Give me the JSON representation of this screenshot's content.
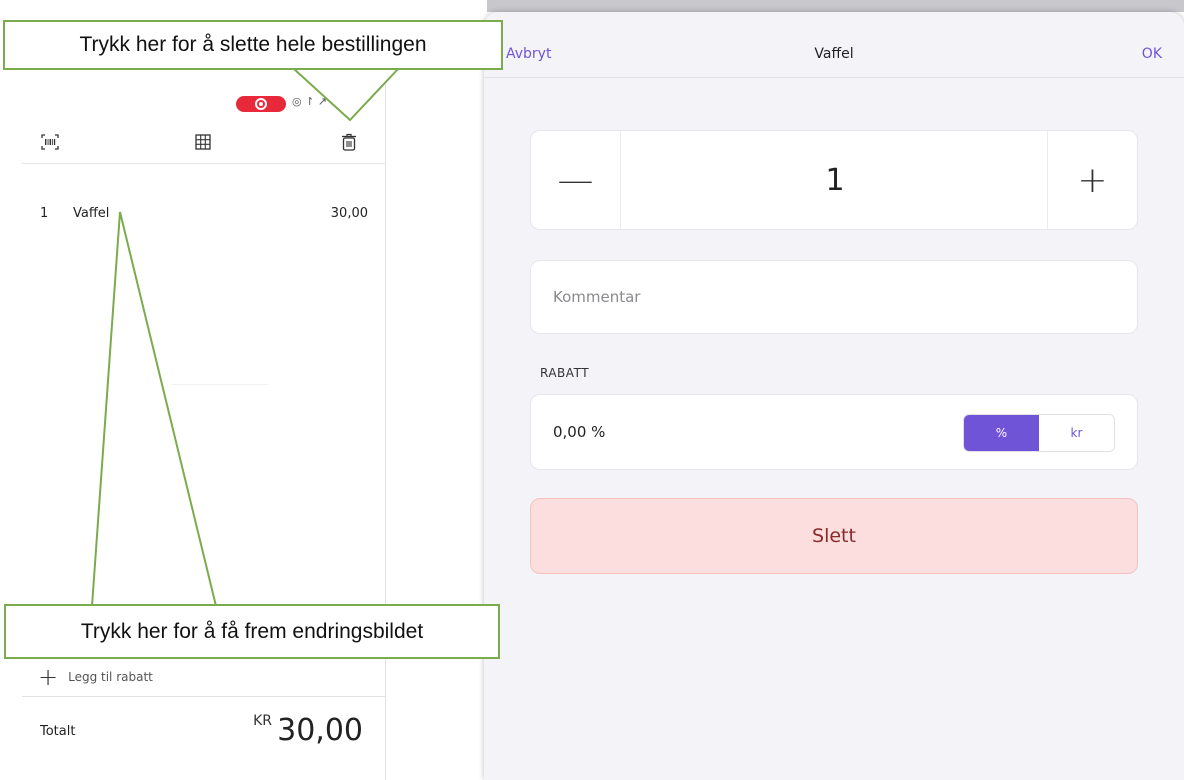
{
  "colors": {
    "accent": "#7054d8",
    "delete_bg": "#fbdedd",
    "delete_text": "#8a2a2a",
    "recording_pill": "#e8293a",
    "callout_border": "#7aab4c"
  },
  "status_bar": {
    "icons": [
      "record-icon",
      "wifi-icon",
      "location-icon"
    ],
    "partial_text": "◎ ↾ ↗ 5"
  },
  "pos": {
    "toolbar": {
      "icons": [
        "barcode-scan-icon",
        "table-grid-icon",
        "trash-icon"
      ]
    },
    "order_items": [
      {
        "qty": "1",
        "name": "Vaffel",
        "price": "30,00"
      }
    ],
    "add_discount_label": "Legg til rabatt",
    "total": {
      "label": "Totalt",
      "currency": "KR",
      "amount": "30,00"
    }
  },
  "dialog": {
    "cancel_label": "Avbryt",
    "title": "Vaffel",
    "ok_label": "OK",
    "quantity": {
      "minus_label": "—",
      "value": "1",
      "plus_label": "+"
    },
    "comment": {
      "placeholder": "Kommentar",
      "value": ""
    },
    "discount": {
      "heading": "RABATT",
      "value": "0,00 %",
      "unit_options": [
        "%",
        "kr"
      ],
      "selected_unit": "%"
    },
    "delete_label": "Slett"
  },
  "annotations": {
    "top_callout": "Trykk her for å slette hele bestillingen",
    "bottom_callout": "Trykk her for å få frem endringsbildet"
  }
}
